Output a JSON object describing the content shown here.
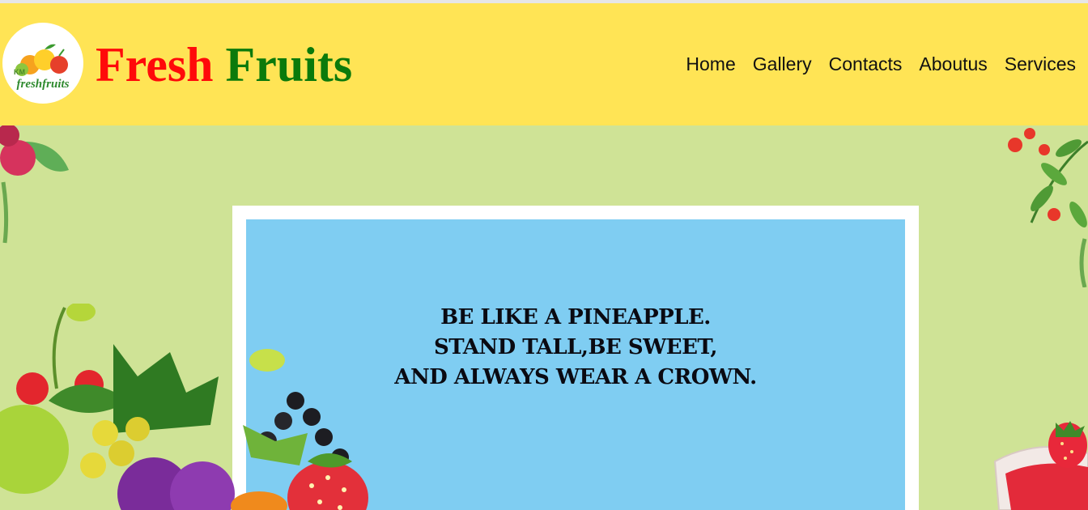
{
  "header": {
    "logo_alt": "freshfruits",
    "brand_part1": "Fresh",
    "brand_part2": "Fruits"
  },
  "nav": {
    "items": [
      "Home",
      "Gallery",
      "Contacts",
      "Aboutus",
      "Services"
    ]
  },
  "hero": {
    "quote_lines": [
      "BE LIKE A PINEAPPLE.",
      "STAND TALL,BE SWEET,",
      "AND ALWAYS WEAR A CROWN."
    ]
  },
  "colors": {
    "header_bg": "#ffe455",
    "page_bg": "#cfe396",
    "panel_bg": "#7fcdf2",
    "brand_red": "#ff0a0a",
    "brand_green": "#0b7a0b"
  }
}
